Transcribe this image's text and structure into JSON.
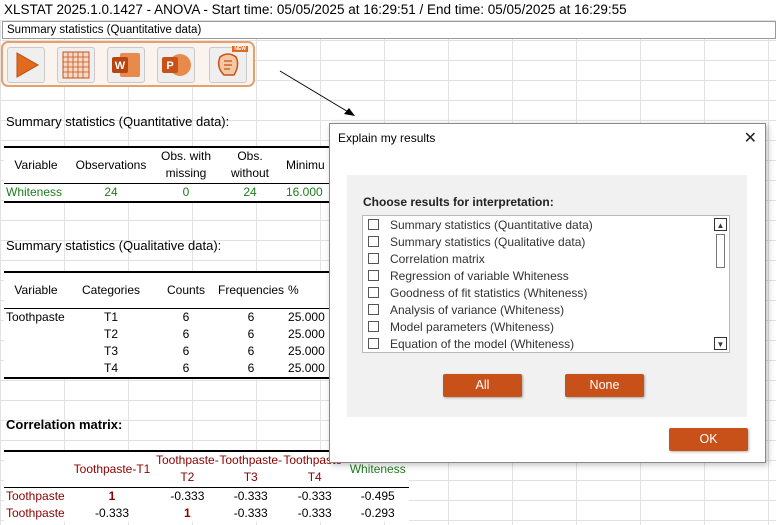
{
  "title_bar": "XLSTAT 2025.1.0.1427 - ANOVA - Start time: 05/05/2025 at 16:29:51 / End time: 05/05/2025 at 16:29:55",
  "sheet_tab": "Summary statistics (Quantitative data)",
  "toolbar": {
    "icons": [
      "play-icon",
      "grid-icon",
      "word-icon",
      "powerpoint-icon",
      "explain-results-icon"
    ],
    "explain_badge": "NEW"
  },
  "quant_stats": {
    "title": "Summary statistics (Quantitative data):",
    "headers": [
      "Variable",
      "Observations",
      "Obs. with missing",
      "Obs. without",
      "Minimu"
    ],
    "rows": [
      [
        "Whiteness",
        "24",
        "0",
        "24",
        "16.000"
      ]
    ]
  },
  "qual_stats": {
    "title": "Summary statistics (Qualitative data):",
    "headers": [
      "Variable",
      "Categories",
      "Counts",
      "Frequencies",
      "%"
    ],
    "rows": [
      [
        "Toothpaste",
        "T1",
        "6",
        "6",
        "25.000"
      ],
      [
        "",
        "T2",
        "6",
        "6",
        "25.000"
      ],
      [
        "",
        "T3",
        "6",
        "6",
        "25.000"
      ],
      [
        "",
        "T4",
        "6",
        "6",
        "25.000"
      ]
    ]
  },
  "corr": {
    "title": "Correlation matrix:",
    "headers": [
      "",
      "Toothpaste-T1",
      "Toothpaste-T2",
      "Toothpaste-T3",
      "Toothpaste-T4",
      "Whiteness"
    ],
    "rows": [
      [
        "Toothpaste",
        "1",
        "-0.333",
        "-0.333",
        "-0.333",
        "-0.495"
      ],
      [
        "Toothpaste",
        "-0.333",
        "1",
        "-0.333",
        "-0.333",
        "-0.293"
      ]
    ]
  },
  "dialog": {
    "title": "Explain my results",
    "choose_label": "Choose results for interpretation:",
    "items": [
      "Summary statistics (Quantitative data)",
      "Summary statistics (Qualitative data)",
      "Correlation matrix",
      "Regression of variable Whiteness",
      "Goodness of fit statistics (Whiteness)",
      "Analysis of variance (Whiteness)",
      "Model parameters (Whiteness)",
      "Equation of the model (Whiteness)"
    ],
    "all_label": "All",
    "none_label": "None",
    "ok_label": "OK"
  },
  "colors": {
    "accent": "#c8511a",
    "toolbar_border": "#e5a070",
    "green_text": "#1d7d1d",
    "dark_red_text": "#8b0000"
  }
}
